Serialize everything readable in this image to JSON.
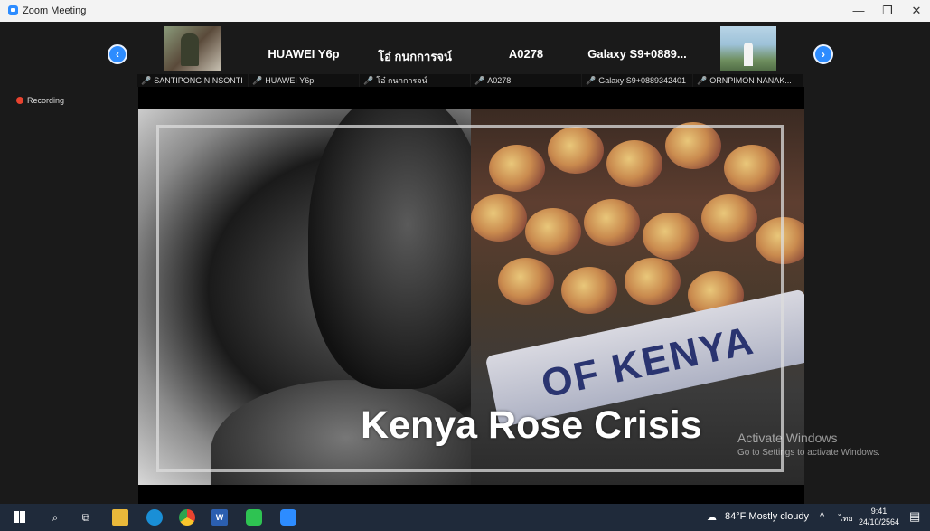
{
  "window": {
    "title": "Zoom Meeting",
    "controls": {
      "minimize": "—",
      "restore": "❐",
      "close": "✕"
    }
  },
  "participants": {
    "prev_arrow": "‹",
    "next_arrow": "›",
    "tiles": [
      {
        "big_name": "",
        "label": "SANTIPONG NINSONTI",
        "muted": true,
        "has_video": true
      },
      {
        "big_name": "HUAWEI Y6p",
        "label": "HUAWEI Y6p",
        "muted": true,
        "has_video": false
      },
      {
        "big_name": "โอ๋ กนกการจน์",
        "label": "โอ๋ กนกการจน์",
        "muted": true,
        "has_video": false
      },
      {
        "big_name": "A0278",
        "label": "A0278",
        "muted": true,
        "has_video": false
      },
      {
        "big_name": "Galaxy S9+0889...",
        "label": "Galaxy S9+0889342401",
        "muted": true,
        "has_video": false
      },
      {
        "big_name": "",
        "label": "ORNPIMON NANAK...",
        "muted": true,
        "has_video": true
      }
    ]
  },
  "recording": {
    "label": "Recording"
  },
  "slide": {
    "title": "Kenya Rose Crisis",
    "band_text": "OF KENYA"
  },
  "watermark": {
    "line1": "Activate Windows",
    "line2": "Go to Settings to activate Windows."
  },
  "taskbar": {
    "weather": "84°F  Mostly cloudy",
    "tray_chevron": "^",
    "input_lang": "ไทย",
    "time": "9:41",
    "date": "24/10/2564"
  },
  "colors": {
    "zoom_blue": "#2d8cff",
    "recording_red": "#e8432f",
    "taskbar_bg": "#1f2a3a"
  }
}
